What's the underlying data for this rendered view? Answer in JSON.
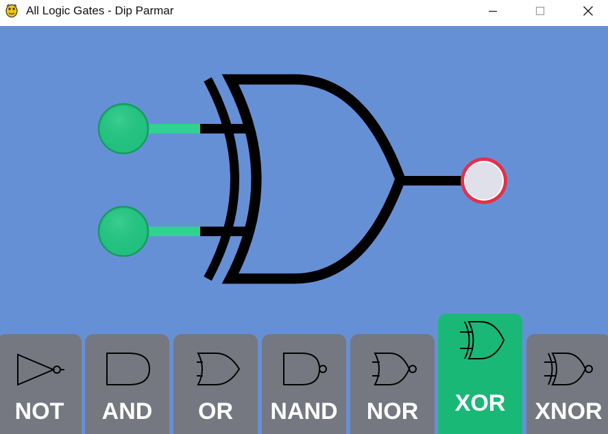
{
  "window": {
    "title": "All Logic Gates - Dip Parmar",
    "controls": [
      "minimize",
      "maximize",
      "close"
    ]
  },
  "colors": {
    "canvas_bg": "#6690d6",
    "tab_bg": "#757881",
    "tab_active_bg": "#1ab876",
    "input_on": "#22c07e",
    "output_off": "#dfe0ea",
    "output_ring": "#e5304a",
    "wire_on": "#2fd28f"
  },
  "circuit": {
    "gate": "XOR",
    "inputs": [
      {
        "name": "input-a",
        "state": true
      },
      {
        "name": "input-b",
        "state": true
      }
    ],
    "output": {
      "state": false
    }
  },
  "tabs": [
    {
      "label": "NOT",
      "icon": "not-gate-icon",
      "active": false
    },
    {
      "label": "AND",
      "icon": "and-gate-icon",
      "active": false
    },
    {
      "label": "OR",
      "icon": "or-gate-icon",
      "active": false
    },
    {
      "label": "NAND",
      "icon": "nand-gate-icon",
      "active": false
    },
    {
      "label": "NOR",
      "icon": "nor-gate-icon",
      "active": false
    },
    {
      "label": "XOR",
      "icon": "xor-gate-icon",
      "active": true
    },
    {
      "label": "XNOR",
      "icon": "xnor-gate-icon",
      "active": false
    }
  ]
}
